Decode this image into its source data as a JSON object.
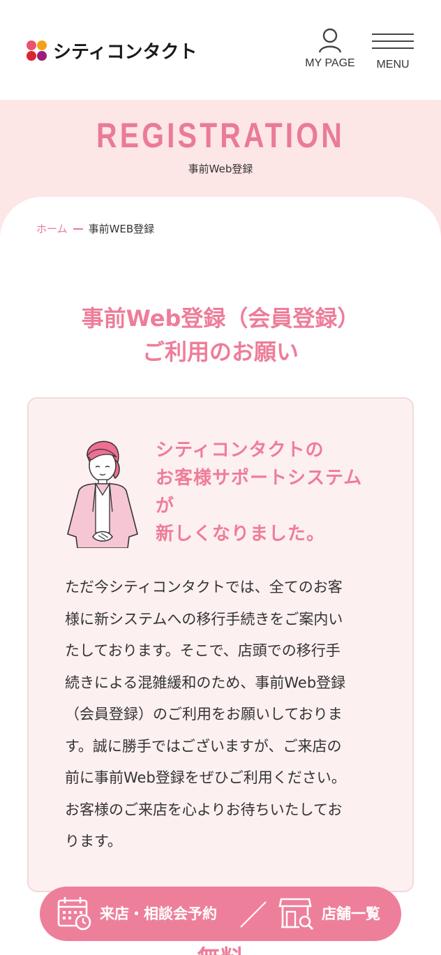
{
  "header": {
    "logo_text": "シティコンタクト",
    "mypage_label": "MY PAGE",
    "menu_label": "MENU"
  },
  "hero": {
    "title": "REGISTRATION",
    "subtitle": "事前Web登録"
  },
  "breadcrumb": {
    "home": "ホーム",
    "current": "事前WEB登録"
  },
  "main": {
    "heading_line1": "事前Web登録（会員登録）",
    "heading_line2": "ご利用のお願い"
  },
  "card": {
    "title_line1": "シティコンタクトの",
    "title_line2": "お客様サポートシステム",
    "title_line3": "が",
    "title_line4": "新しくなりました。",
    "body_lines": [
      "ただ今シティコンタクトでは、全てのお客",
      "様に新システムへの移行手続きをご案内い",
      "たしております。そこで、店頭での移行手",
      "続きによる混雑緩和のため、事前Web登録",
      "（会員登録）のご利用をお願いしておりま",
      "す。誠に勝手ではございますが、ご来店の",
      "前に事前Web登録をぜひご利用ください。",
      "お客様のご来店を心よりお待ちいたしてお",
      "ります。"
    ]
  },
  "float_bar": {
    "reserve_label": "来店・相談会予約",
    "stores_label": "店舗一覧"
  },
  "below_text": "無料",
  "colors": {
    "accent": "#ee7d99",
    "hero_bg": "#fde6e6",
    "card_bg": "#fdf0f0"
  }
}
